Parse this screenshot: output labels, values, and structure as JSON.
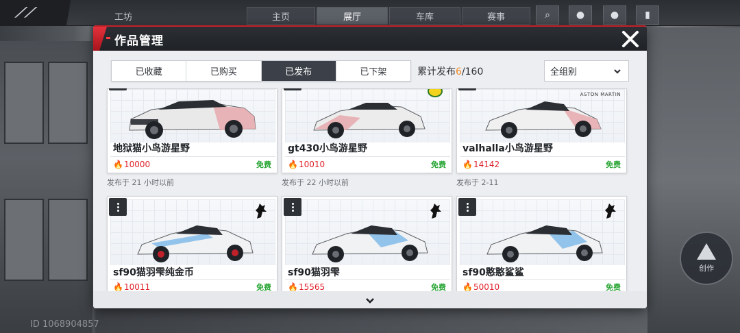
{
  "background": {
    "nav_items": [
      "主页",
      "展厅",
      "车库",
      "赛事"
    ],
    "side_label": "工坊",
    "player_id": "ID 1068904857",
    "round_button_label": "创作"
  },
  "dialog": {
    "title": "作品管理",
    "close_icon": "close-icon",
    "tabs": [
      {
        "label": "已收藏",
        "active": false
      },
      {
        "label": "已购买",
        "active": false
      },
      {
        "label": "已发布",
        "active": true
      },
      {
        "label": "已下架",
        "active": false
      }
    ],
    "counter": {
      "prefix": "累计发布",
      "current": "6",
      "sep": "/",
      "total": "160"
    },
    "group_select": {
      "value": "全组别"
    },
    "accent_color": "#c7202a",
    "works": [
      {
        "name": "地狱猫小鸟游星野",
        "heat": "10000",
        "price": "免费",
        "published": "发布于 21 小时以前",
        "brand": "",
        "car": "muscle"
      },
      {
        "name": "gt430小鸟游星野",
        "heat": "10010",
        "price": "免费",
        "published": "发布于 22 小时以前",
        "brand": "lotus-badge",
        "car": "sport"
      },
      {
        "name": "valhalla小鸟游星野",
        "heat": "14142",
        "price": "免费",
        "published": "发布于 2-11",
        "brand": "ASTON MARTIN",
        "car": "hyper"
      },
      {
        "name": "sf90猫羽雫纯金币",
        "heat": "10011",
        "price": "免费",
        "published": "",
        "brand": "ferrari-horse",
        "car": "sf90"
      },
      {
        "name": "sf90猫羽雫",
        "heat": "15565",
        "price": "免费",
        "published": "",
        "brand": "ferrari-horse",
        "car": "sf90"
      },
      {
        "name": "sf90憨憨鲨鲨",
        "heat": "50010",
        "price": "免费",
        "published": "",
        "brand": "ferrari-horse",
        "car": "sf90"
      }
    ]
  }
}
